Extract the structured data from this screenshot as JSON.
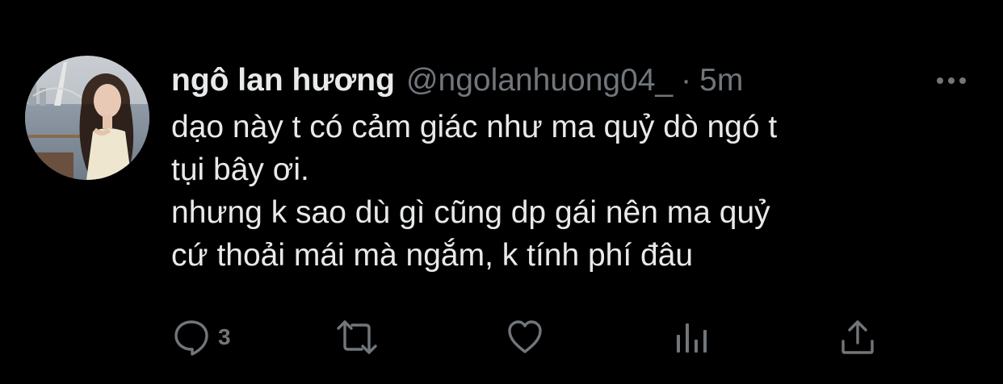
{
  "tweet": {
    "display_name": "ngô lan hương",
    "handle": "@ngolanhuong04_",
    "separator": "·",
    "time": "5m",
    "text_lines": [
      "dạo này t có cảm giác như ma quỷ dò ngó t",
      "tụi bây ơi.",
      "nhưng k sao dù gì cũng dp gái nên ma quỷ",
      "cứ thoải mái mà ngắm, k tính phí đâu"
    ]
  },
  "actions": {
    "reply_count": "3"
  },
  "colors": {
    "background": "#000000",
    "text_primary": "#e7e9ea",
    "text_secondary": "#71767b"
  },
  "icons": [
    "avatar",
    "more-icon",
    "reply-icon",
    "retweet-icon",
    "like-icon",
    "views-icon",
    "share-icon"
  ]
}
